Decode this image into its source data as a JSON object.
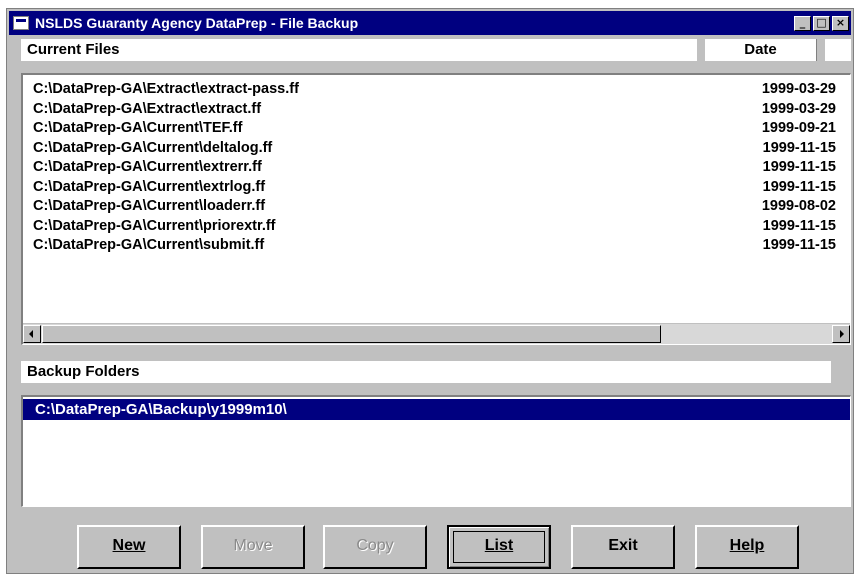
{
  "window": {
    "title": "NSLDS Guaranty Agency DataPrep - File Backup",
    "controls": {
      "minimize": "_",
      "maximize": "□",
      "close": "×"
    }
  },
  "current_files": {
    "header": "Current Files",
    "date_header": "Date",
    "rows": [
      {
        "path": "C:\\DataPrep-GA\\Extract\\extract-pass.ff",
        "date": "1999-03-29"
      },
      {
        "path": "C:\\DataPrep-GA\\Extract\\extract.ff",
        "date": "1999-03-29"
      },
      {
        "path": "C:\\DataPrep-GA\\Current\\TEF.ff",
        "date": "1999-09-21"
      },
      {
        "path": "C:\\DataPrep-GA\\Current\\deltalog.ff",
        "date": "1999-11-15"
      },
      {
        "path": "C:\\DataPrep-GA\\Current\\extrerr.ff",
        "date": "1999-11-15"
      },
      {
        "path": "C:\\DataPrep-GA\\Current\\extrlog.ff",
        "date": "1999-11-15"
      },
      {
        "path": "C:\\DataPrep-GA\\Current\\loaderr.ff",
        "date": "1999-08-02"
      },
      {
        "path": "C:\\DataPrep-GA\\Current\\priorextr.ff",
        "date": "1999-11-15"
      },
      {
        "path": "C:\\DataPrep-GA\\Current\\submit.ff",
        "date": "1999-11-15"
      }
    ]
  },
  "backup_folders": {
    "header": "Backup Folders",
    "selected": "C:\\DataPrep-GA\\Backup\\y1999m10\\"
  },
  "buttons": {
    "new": "New",
    "move": "Move",
    "copy": "Copy",
    "list": "List",
    "exit": "Exit",
    "help": "Help"
  },
  "colors": {
    "title_bar": "#000080",
    "selection": "#000080",
    "face": "#c0c0c0"
  }
}
